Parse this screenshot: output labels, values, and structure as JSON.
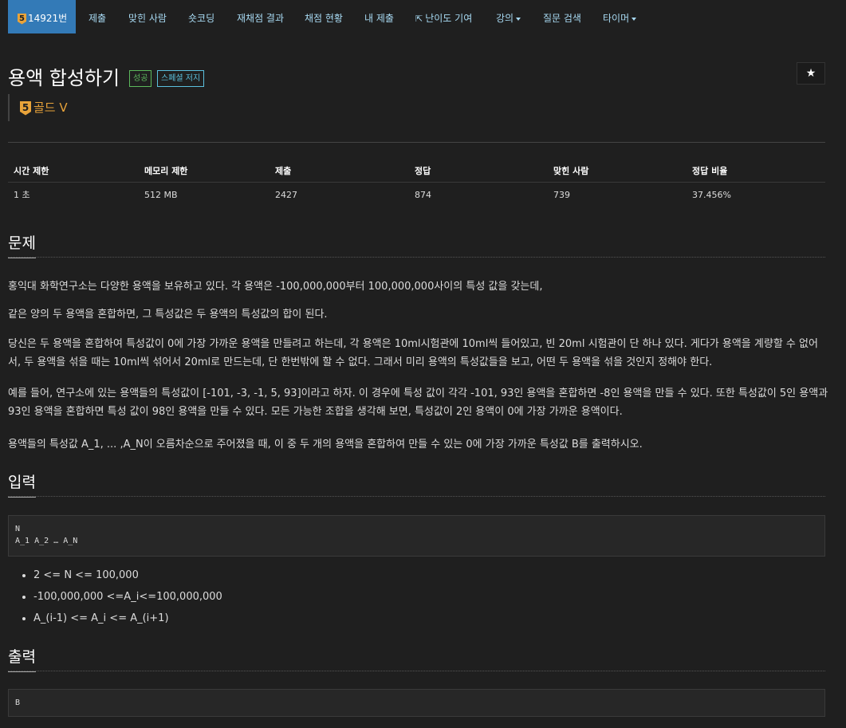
{
  "nav": {
    "problem_number": "14921번",
    "tier_num": "5",
    "items": [
      {
        "label": "제출"
      },
      {
        "label": "맞힌 사람"
      },
      {
        "label": "숏코딩"
      },
      {
        "label": "재채점 결과"
      },
      {
        "label": "채점 현황"
      },
      {
        "label": "내 제출"
      },
      {
        "label": "난이도 기여"
      },
      {
        "label": "강의"
      },
      {
        "label": "질문 검색"
      },
      {
        "label": "타이머"
      }
    ]
  },
  "problem": {
    "title": "용액 합성하기",
    "labels": [
      "성공",
      "스페셜 저지"
    ],
    "tier_num": "5",
    "tier_text": "골드 V"
  },
  "stats": {
    "headers": [
      "시간 제한",
      "메모리 제한",
      "제출",
      "정답",
      "맞힌 사람",
      "정답 비율"
    ],
    "values": [
      "1 초",
      "512 MB",
      "2427",
      "874",
      "739",
      "37.456%"
    ]
  },
  "sections": {
    "problem_heading": "문제",
    "paragraphs": [
      "홍익대 화학연구소는 다양한 용액을 보유하고 있다.  각 용액은 -100,000,000부터 100,000,000사이의 특성 값을 갖는데,",
      "같은 양의 두 용액을 혼합하면, 그 특성값은 두 용액의 특성값의 합이 된다.",
      "당신은 두 용액을 혼합하여 특성값이 0에 가장 가까운 용액을 만들려고 하는데, 각 용액은 10ml시험관에 10ml씩 들어있고, 빈 20ml 시험관이 단 하나 있다.  게다가 용액을 계량할 수 없어서, 두 용액을 섞을 때는 10ml씩 섞어서 20ml로 만드는데, 단 한번밖에 할 수 없다.  그래서 미리 용액의 특성값들을 보고, 어떤 두 용액을 섞을 것인지 정해야 한다.",
      "예를 들어, 연구소에 있는 용액들의 특성값이 [-101, -3, -1, 5, 93]이라고 하자. 이 경우에 특성 값이 각각 -101, 93인 용액을 혼합하면 -8인 용액을 만들 수 있다. 또한 특성값이 5인 용액과 93인 용액을 혼합하면 특성 값이 98인 용액을 만들 수 있다.  모든 가능한 조합을 생각해 보면, 특성값이 2인 용액이 0에 가장 가까운 용액이다.",
      "용액들의 특성값 A_1, ... ,A_N이 오름차순으로 주어졌을 때, 이 중 두 개의 용액을 혼합하여 만들 수 있는 0에 가장 가까운 특성값 B를 출력하시오."
    ],
    "input_heading": "입력",
    "input_code": "N\nA_1 A_2 … A_N",
    "constraints": [
      "2 <= N <= 100,000",
      "-100,000,000 <=A_i<=100,000,000",
      "A_(i-1) <= A_i <= A_(i+1)"
    ],
    "output_heading": "출력",
    "output_code": "B"
  },
  "colors": {
    "background": "#1f1f1f",
    "nav_active": "#337ab7",
    "nav_link": "#a7d9f2",
    "success": "#5cb85c",
    "special": "#5bc0de",
    "gold": "#e8a33a"
  }
}
